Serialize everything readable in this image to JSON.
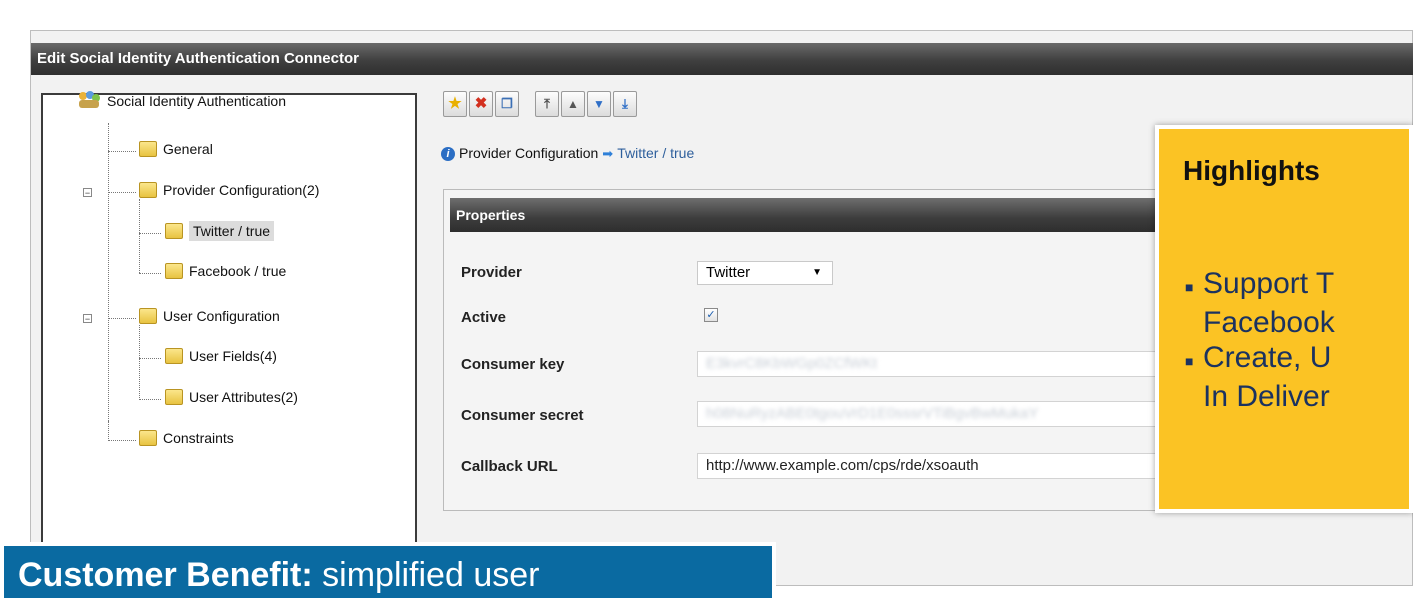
{
  "window": {
    "title": "Edit Social Identity Authentication Connector"
  },
  "tree": {
    "root": "Social Identity Authentication",
    "items": [
      {
        "label": "General"
      },
      {
        "label": "Provider Configuration(2)"
      },
      {
        "label": "Twitter / true",
        "selected": true
      },
      {
        "label": "Facebook / true"
      },
      {
        "label": "User Configuration"
      },
      {
        "label": "User Fields(4)"
      },
      {
        "label": "User Attributes(2)"
      },
      {
        "label": "Constraints"
      }
    ]
  },
  "toolbar": {
    "icons": [
      "new-star-icon",
      "delete-x-icon",
      "copy-icon",
      "move-top-icon",
      "move-up-icon",
      "move-down-icon",
      "move-bottom-icon"
    ]
  },
  "breadcrumb": {
    "section": "Provider Configuration",
    "current": "Twitter / true"
  },
  "properties": {
    "header": "Properties",
    "provider_label": "Provider",
    "provider_value": "Twitter",
    "active_label": "Active",
    "active_checked": true,
    "consumer_key_label": "Consumer key",
    "consumer_key_value": "E3kvrC8KbWGp0ZCfWKt",
    "consumer_secret_label": "Consumer secret",
    "consumer_secret_value": "h08NuRyzABE0tgouVrD1E0sssrVTiBgvBwMukaY",
    "callback_url_label": "Callback URL",
    "callback_url_value": "http://www.example.com/cps/rde/xsoauth"
  },
  "highlights": {
    "title": "Highlights",
    "line1": "Support T",
    "line2": "Facebook",
    "line3": "Create, U",
    "line4": "In Deliver"
  },
  "benefit": {
    "label": "Customer Benefit:",
    "text": "simplified user"
  },
  "colors": {
    "highlight_bg": "#fbc324",
    "benefit_bg": "#0a6aa1",
    "titlebar": "#3f3f3f"
  }
}
